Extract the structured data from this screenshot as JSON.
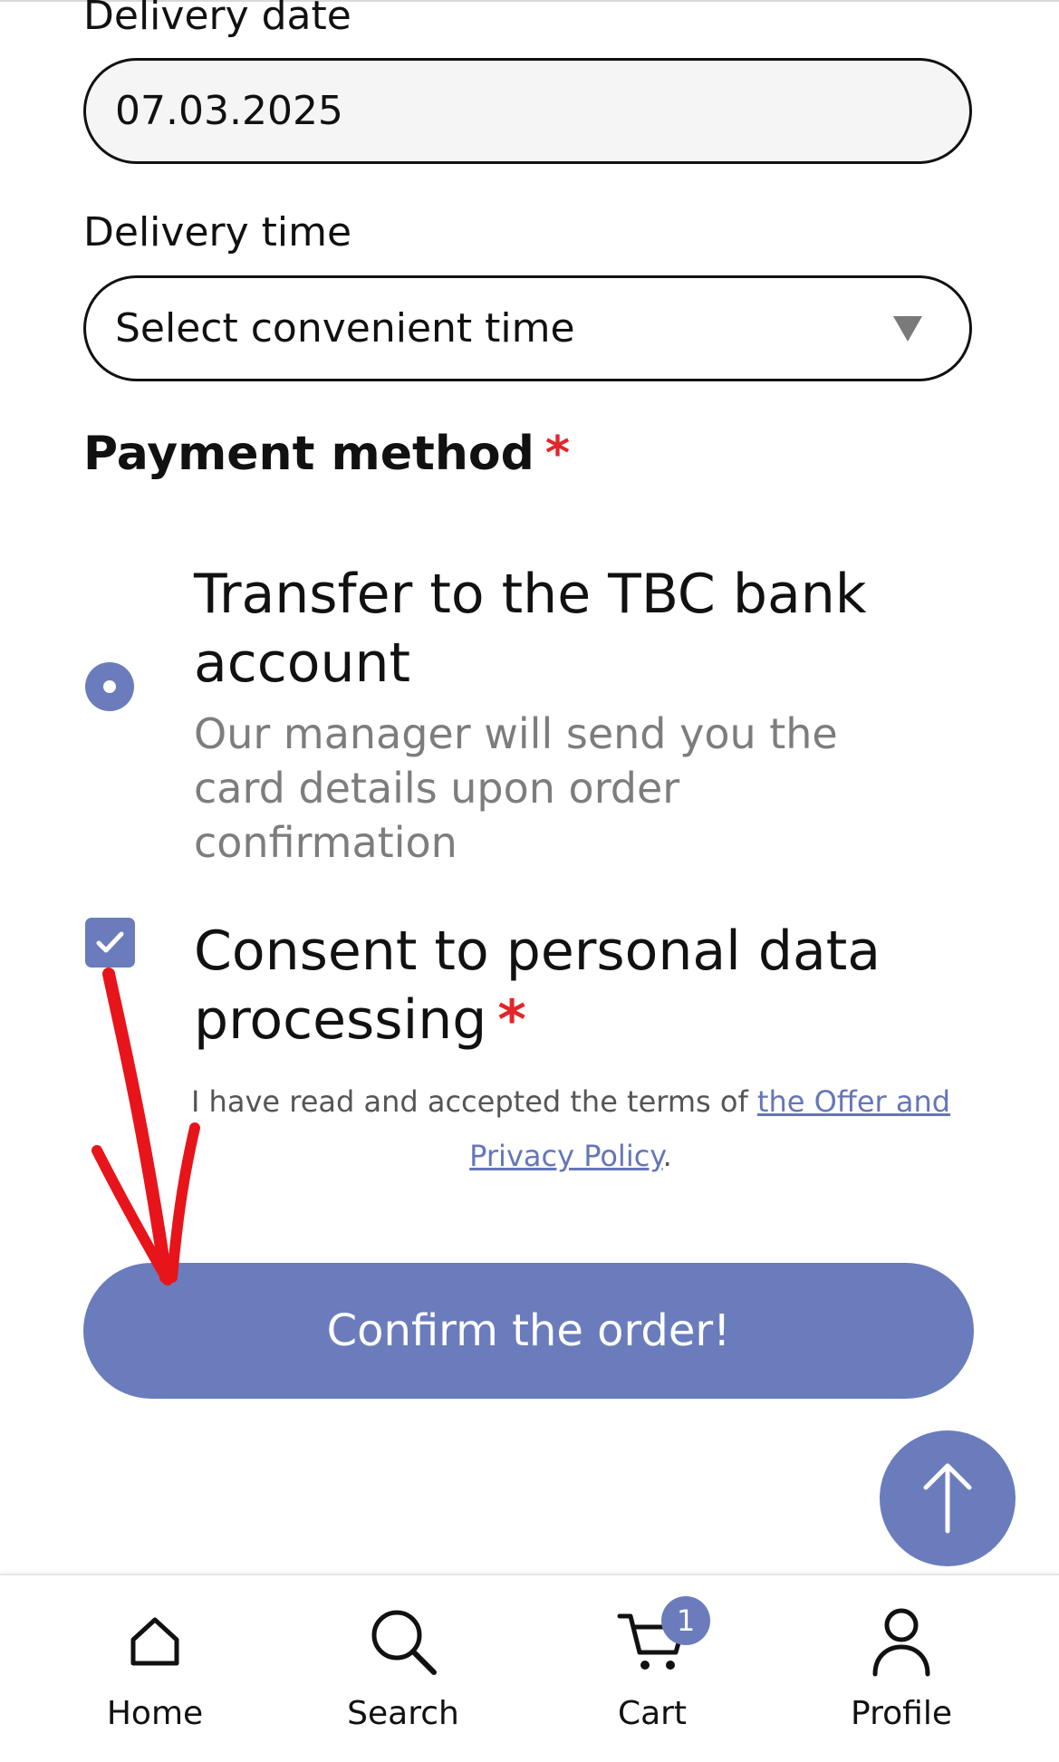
{
  "delivery_date": {
    "label": "Delivery date",
    "value": "07.03.2025"
  },
  "delivery_time": {
    "label": "Delivery time",
    "placeholder": "Select convenient time"
  },
  "payment": {
    "title": "Payment method",
    "required_mark": "*",
    "option_title": "Transfer to the TBC bank account",
    "option_description": "Our manager will send you the card details upon order confirmation"
  },
  "consent": {
    "title": "Consent to personal data processing",
    "required_mark": "*",
    "terms_prefix": "I have read and accepted the terms of ",
    "terms_link": "the Offer and Privacy Policy",
    "terms_suffix": "."
  },
  "confirm_button": "Confirm the order!",
  "nav": {
    "home": "Home",
    "search": "Search",
    "cart": "Cart",
    "cart_badge": "1",
    "profile": "Profile"
  },
  "colors": {
    "accent": "#6a7cbc",
    "required": "#e3262b",
    "annotation_arrow": "#e8141b"
  }
}
